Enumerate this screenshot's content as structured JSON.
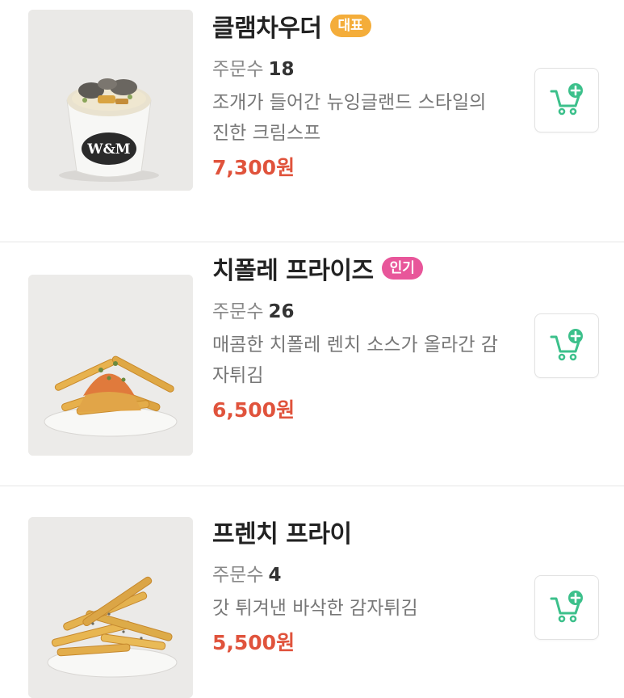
{
  "menu": {
    "items": [
      {
        "name": "클램차우더",
        "badge": "대표",
        "badge_color": "#f4ad3a",
        "orders_label": "주문수",
        "orders": "18",
        "description": "조개가 들어간 뉴잉글랜드 스타일의 진한 크림스프",
        "price": "7,300원",
        "image_icon": "clam-chowder-photo",
        "cart_icon": "cart-add-icon",
        "logo_text": "W&M"
      },
      {
        "name": "치폴레 프라이즈",
        "badge": "인기",
        "badge_color": "#e8569a",
        "orders_label": "주문수",
        "orders": "26",
        "description": "매콤한 치폴레 렌치 소스가 올라간 감자튀김",
        "price": "6,500원",
        "image_icon": "chipotle-fries-photo",
        "cart_icon": "cart-add-icon"
      },
      {
        "name": "프렌치 프라이",
        "badge": "",
        "orders_label": "주문수",
        "orders": "4",
        "description": "갓 튀겨낸 바삭한 감자튀김",
        "price": "5,500원",
        "image_icon": "french-fries-photo",
        "cart_icon": "cart-add-icon"
      }
    ]
  },
  "colors": {
    "price": "#e0533c",
    "cart_accent": "#3cc08b"
  }
}
